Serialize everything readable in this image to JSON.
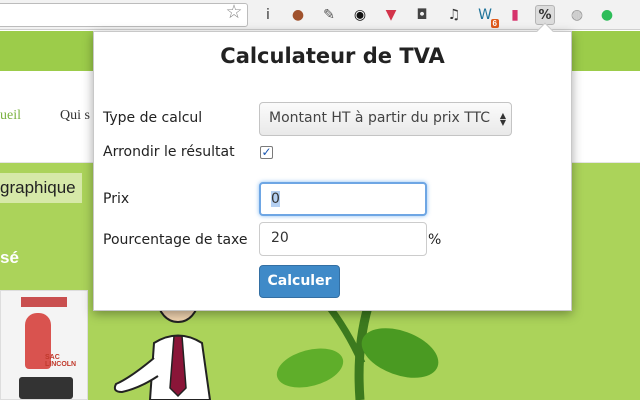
{
  "browser": {
    "extensions": [
      {
        "name": "info",
        "glyph": "i"
      },
      {
        "name": "cookie",
        "glyph": "●"
      },
      {
        "name": "color-picker",
        "glyph": "✎"
      },
      {
        "name": "eye",
        "glyph": "◉"
      },
      {
        "name": "pocket",
        "glyph": "▼"
      },
      {
        "name": "camera",
        "glyph": "◘"
      },
      {
        "name": "music",
        "glyph": "♫"
      },
      {
        "name": "wordpress",
        "glyph": "W",
        "badge": "6"
      },
      {
        "name": "phone",
        "glyph": "▮"
      },
      {
        "name": "vat-calculator",
        "glyph": "%"
      },
      {
        "name": "globe",
        "glyph": "◍"
      },
      {
        "name": "evernote",
        "glyph": "●"
      }
    ]
  },
  "page": {
    "nav_link_1": "ueil",
    "nav_link_2": "Qui s",
    "section_title": "graphique",
    "section_sub": "sé",
    "thumb_text": "SAC LINCOLN"
  },
  "popup": {
    "title": "Calculateur de TVA",
    "calc_type_label": "Type de calcul",
    "calc_type_value": "Montant HT à partir du prix TTC",
    "round_label": "Arrondir le résultat",
    "round_checked": true,
    "price_label": "Prix",
    "price_value": "0",
    "tax_label": "Pourcentage de taxe",
    "tax_value": "20",
    "tax_unit": "%",
    "submit_label": "Calculer"
  },
  "colors": {
    "page_green": "#abd35a",
    "topbar_green": "#9ccc4a",
    "button_blue": "#3f8ac8"
  }
}
